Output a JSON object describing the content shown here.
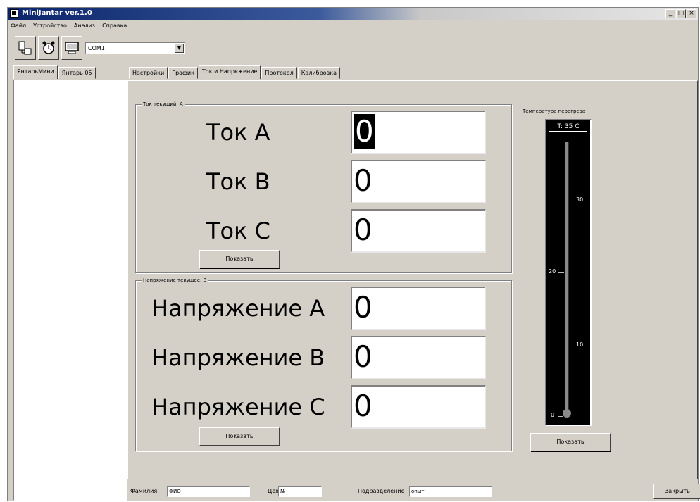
{
  "window": {
    "title": "MiniJantar ver.1.0"
  },
  "menu": {
    "items": [
      "Файл",
      "Устройство",
      "Анализ",
      "Справка"
    ]
  },
  "toolbar": {
    "port_value": "COM1"
  },
  "left_tabs": [
    "ЯнтарьМини",
    "Янтарь 05"
  ],
  "main_tabs": [
    "Настройки",
    "График",
    "Ток и Напряжение",
    "Протокол",
    "Калибровка"
  ],
  "current_group": {
    "title": "Ток текущий, А",
    "rows": [
      {
        "label": "Ток A",
        "value": "0"
      },
      {
        "label": "Ток B",
        "value": "0"
      },
      {
        "label": "Ток C",
        "value": "0"
      }
    ],
    "button": "Показать"
  },
  "voltage_group": {
    "title": "Напряжение текущее, В",
    "rows": [
      {
        "label": "Напряжение A",
        "value": "0"
      },
      {
        "label": "Напряжение B",
        "value": "0"
      },
      {
        "label": "Напряжение C",
        "value": "0"
      }
    ],
    "button": "Показать"
  },
  "thermometer": {
    "title": "Температура перегрева",
    "readout": "T: 35  C",
    "value": 35,
    "range": [
      0,
      35
    ],
    "tick_labels": [
      "30",
      "20",
      "10",
      "0"
    ],
    "button": "Показать"
  },
  "status": {
    "surname_label": "Фамилия",
    "surname_value": "ФИО",
    "shop_label": "Цех",
    "shop_value": "№",
    "division_label": "Подразделение",
    "division_value": "опыт",
    "close_button": "Закрыть"
  }
}
